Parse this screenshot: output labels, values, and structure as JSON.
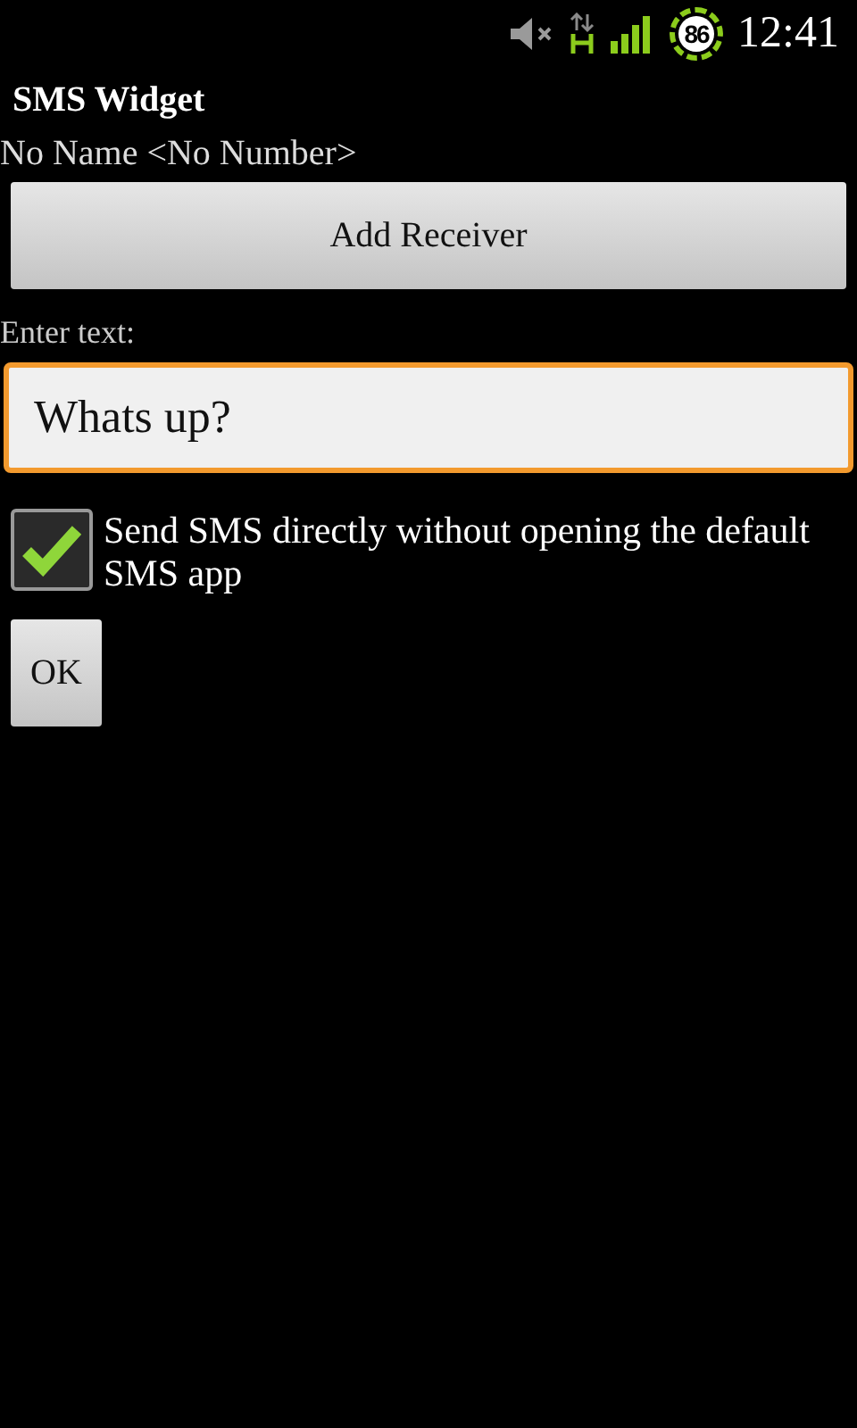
{
  "status_bar": {
    "battery": "86",
    "time": "12:41"
  },
  "window": {
    "title": "SMS Widget"
  },
  "receiver": "No Name <No Number>",
  "add_button": "Add Receiver",
  "text_label": "Enter text:",
  "text_field": {
    "value": "Whats up?",
    "focused": true
  },
  "send_directly": {
    "label": "Send SMS directly without opening the default SMS app",
    "checked": true
  },
  "ok_button": "OK"
}
